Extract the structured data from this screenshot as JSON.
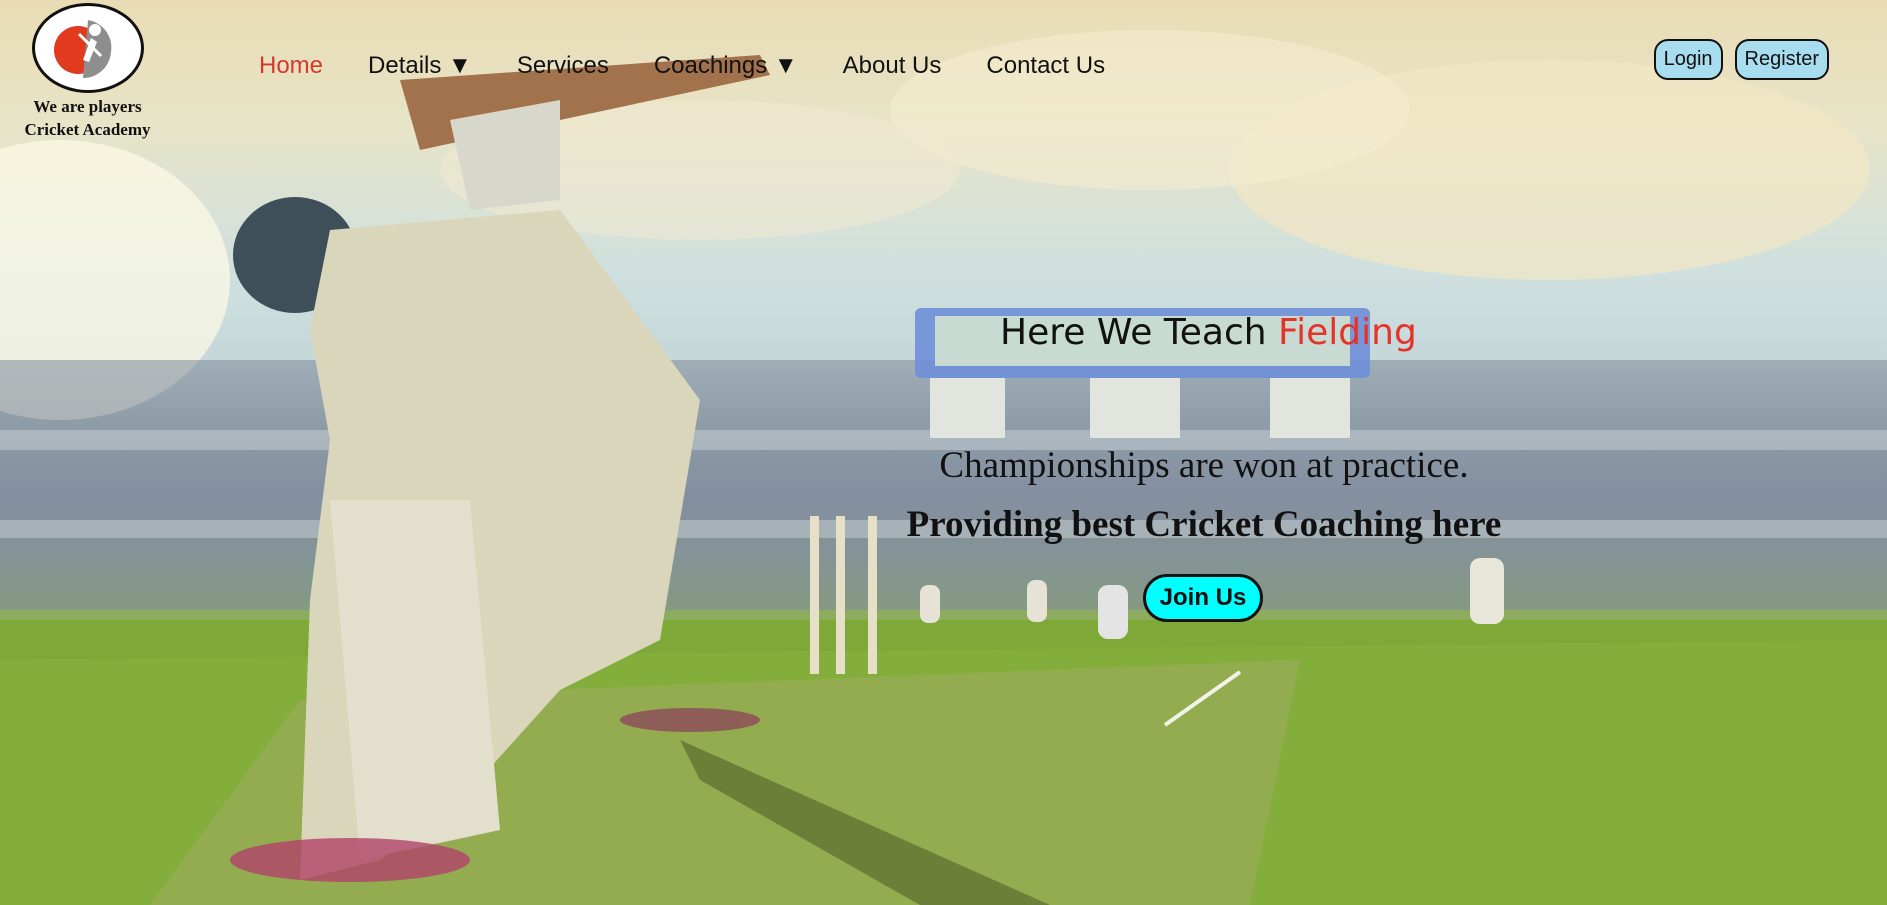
{
  "brand": {
    "name_line1": "We are players",
    "name_line2": "Cricket Academy"
  },
  "nav": {
    "items": [
      {
        "label": "Home",
        "active": true
      },
      {
        "label": "Details ▼",
        "active": false
      },
      {
        "label": "Services",
        "active": false
      },
      {
        "label": "Coachings ▼",
        "active": false
      },
      {
        "label": "About Us",
        "active": false
      },
      {
        "label": "Contact Us",
        "active": false
      }
    ]
  },
  "auth": {
    "login_label": "Login",
    "register_label": "Register"
  },
  "hero": {
    "headline_prefix": "Here We Teach",
    "headline_accent": "Fielding",
    "tagline": "Championships are won at practice.",
    "subtagline": "Providing best Cricket Coaching here",
    "cta_label": "Join Us"
  },
  "colors": {
    "active_nav": "#d6382c",
    "accent_word": "#e5332a",
    "auth_button_bg": "#a8dcef",
    "cta_bg": "#00ffff"
  }
}
